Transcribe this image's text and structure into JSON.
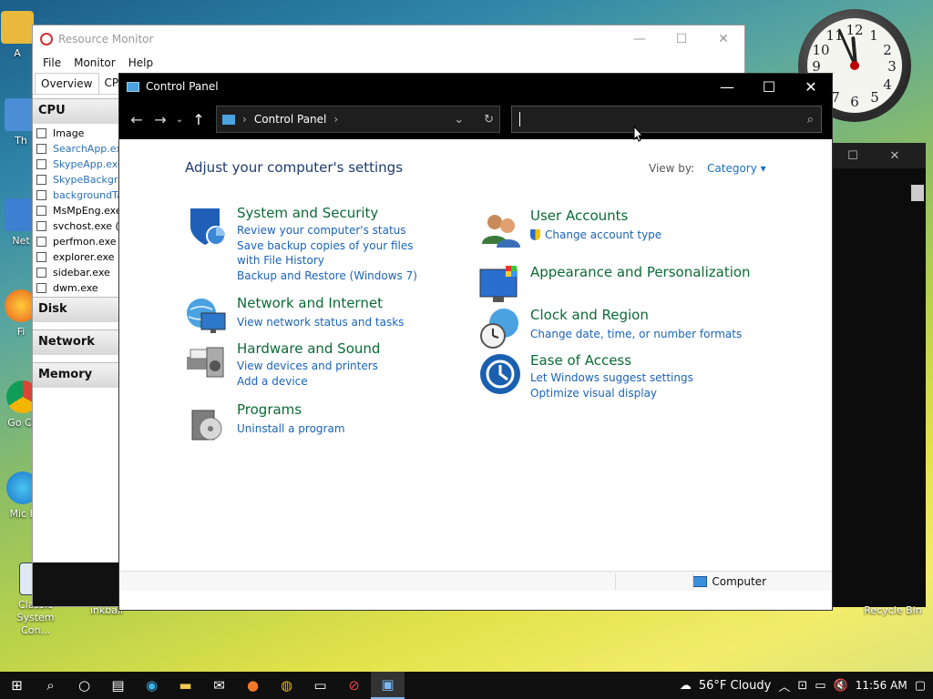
{
  "desktop": {
    "icons": [
      {
        "label": "A"
      },
      {
        "label": "Th"
      },
      {
        "label": "Net"
      },
      {
        "label": "Fi"
      },
      {
        "label": "Go Ch"
      },
      {
        "label": "Mic E"
      },
      {
        "label": "Classic System Con..."
      },
      {
        "label": "inkball"
      }
    ],
    "recycle_bin": "Recycle Bin"
  },
  "clock": {
    "numerals": [
      "12",
      "1",
      "2",
      "3",
      "4",
      "5",
      "6",
      "7",
      "8",
      "9",
      "10",
      "11"
    ]
  },
  "resource_monitor": {
    "title": "Resource Monitor",
    "menu": [
      "File",
      "Monitor",
      "Help"
    ],
    "tabs": [
      "Overview",
      "CPU"
    ],
    "sections": {
      "cpu": "CPU",
      "disk": "Disk",
      "network": "Network",
      "memory": "Memory"
    },
    "cpu_header": "Image",
    "processes": [
      "SearchApp.exe",
      "SkypeApp.exe",
      "SkypeBackgro",
      "backgroundTa",
      "MsMpEng.exe",
      "svchost.exe (Lo",
      "perfmon.exe",
      "explorer.exe",
      "sidebar.exe",
      "dwm.exe"
    ]
  },
  "control_panel": {
    "title": "Control Panel",
    "breadcrumb": "Control Panel",
    "search_placeholder": "",
    "heading": "Adjust your computer's settings",
    "view_by_label": "View by:",
    "view_by_value": "Category",
    "categories_left": [
      {
        "title": "System and Security",
        "links": [
          "Review your computer's status",
          "Save backup copies of your files with File History",
          "Backup and Restore (Windows 7)"
        ]
      },
      {
        "title": "Network and Internet",
        "links": [
          "View network status and tasks"
        ]
      },
      {
        "title": "Hardware and Sound",
        "links": [
          "View devices and printers",
          "Add a device"
        ]
      },
      {
        "title": "Programs",
        "links": [
          "Uninstall a program"
        ]
      }
    ],
    "categories_right": [
      {
        "title": "User Accounts",
        "links": [
          "Change account type"
        ]
      },
      {
        "title": "Appearance and Personalization",
        "links": []
      },
      {
        "title": "Clock and Region",
        "links": [
          "Change date, time, or number formats"
        ]
      },
      {
        "title": "Ease of Access",
        "links": [
          "Let Windows suggest settings",
          "Optimize visual display"
        ]
      }
    ],
    "status_text": "Computer"
  },
  "taskbar": {
    "weather": "56°F  Cloudy",
    "time": "11:56 AM"
  },
  "colors": {
    "link": "#1a63b8",
    "category_title": "#0a6b34",
    "heading": "#1e3b70"
  }
}
